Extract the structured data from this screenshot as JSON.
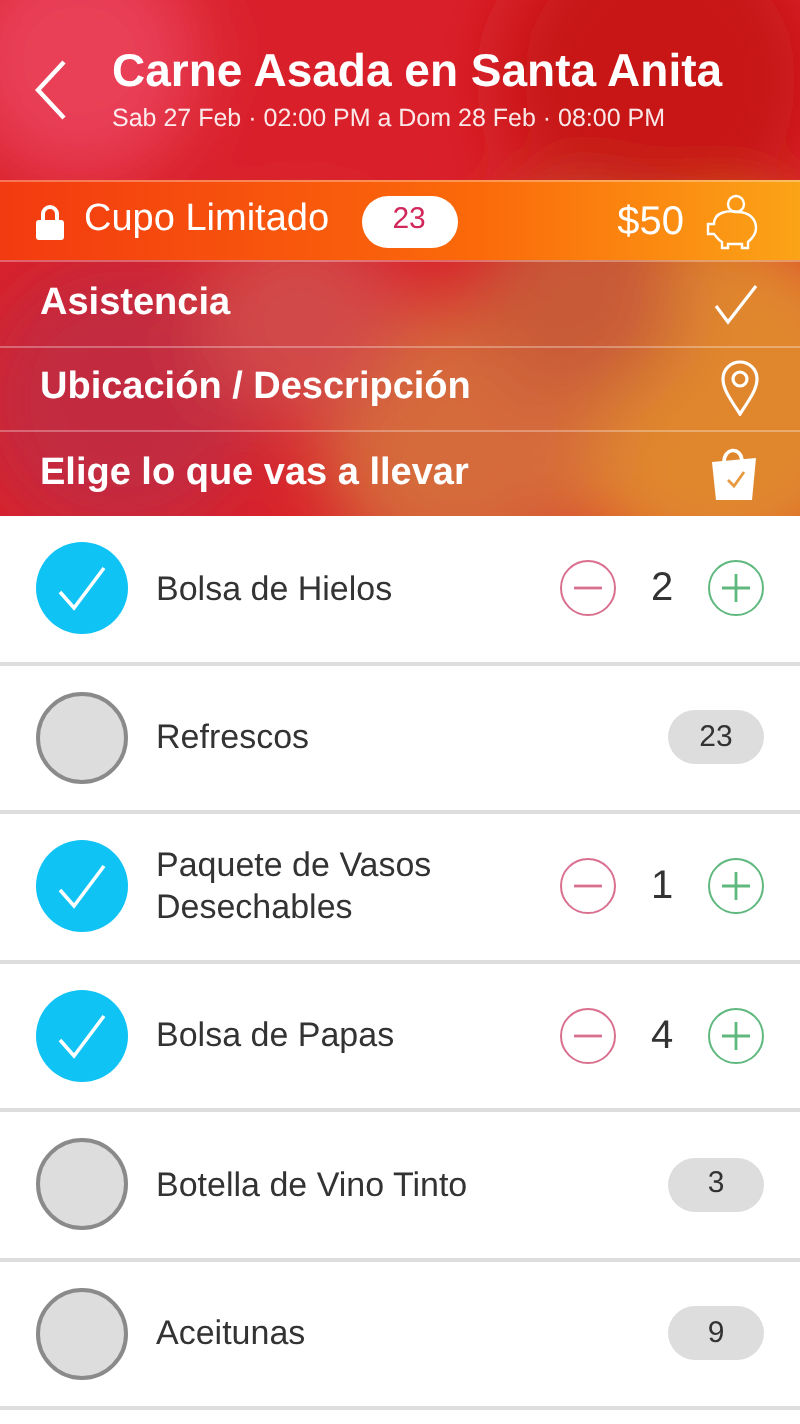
{
  "header": {
    "title": "Carne Asada en Santa Anita",
    "subtitle": "Sab 27 Feb · 02:00 PM a Dom 28 Feb · 08:00 PM"
  },
  "quota": {
    "label": "Cupo Limitado",
    "count": "23",
    "price": "$50"
  },
  "menu": [
    {
      "label": "Asistencia"
    },
    {
      "label": "Ubicación / Descripción"
    },
    {
      "label": "Elige lo que vas a llevar"
    }
  ],
  "items": [
    {
      "name": "Bolsa de Hielos",
      "checked": true,
      "kind": "stepper",
      "quantity": "2"
    },
    {
      "name": "Refrescos",
      "checked": false,
      "kind": "count",
      "count": "23"
    },
    {
      "name": "Paquete de Vasos Desechables",
      "checked": true,
      "kind": "stepper",
      "quantity": "1"
    },
    {
      "name": "Bolsa de Papas",
      "checked": true,
      "kind": "stepper",
      "quantity": "4"
    },
    {
      "name": "Botella de Vino Tinto",
      "checked": false,
      "kind": "count",
      "count": "3"
    },
    {
      "name": "Aceitunas",
      "checked": false,
      "kind": "count",
      "count": "9"
    }
  ]
}
